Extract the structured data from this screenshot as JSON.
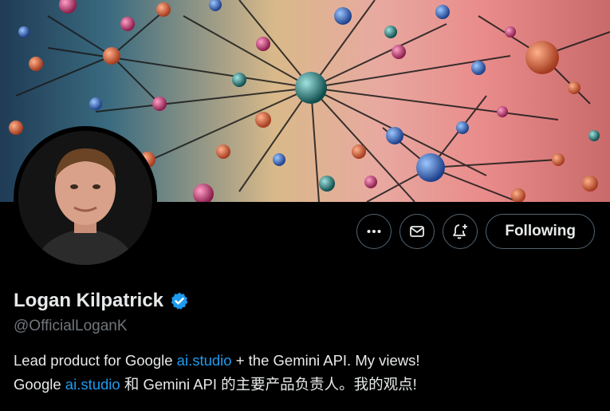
{
  "profile": {
    "display_name": "Logan Kilpatrick",
    "handle": "@OfficialLoganK",
    "verified_icon": "verified-badge-icon",
    "bio_line1": {
      "before": "Lead product for Google ",
      "link": "ai.studio",
      "after": " + the Gemini API. My views!"
    },
    "bio_line2": {
      "before": "Google ",
      "link": "ai.studio",
      "after": " 和 Gemini API 的主要产品负责人。我的观点!"
    }
  },
  "actions": {
    "more_icon": "more-dots-icon",
    "message_icon": "envelope-icon",
    "notify_icon": "bell-plus-icon",
    "follow_label": "Following"
  },
  "colors": {
    "background": "#000000",
    "text": "#e7e9ea",
    "muted": "#71767b",
    "link": "#1d9bf0",
    "border": "#536471",
    "verified": "#1d9bf0"
  }
}
